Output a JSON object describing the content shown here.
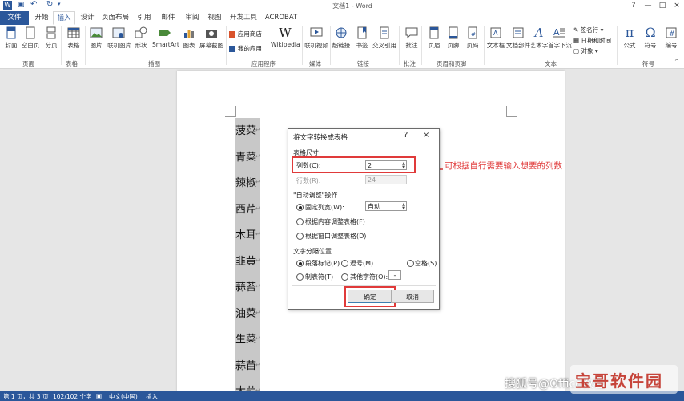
{
  "app": {
    "title": "文档1 - Word",
    "quick_access": [
      "save-icon",
      "undo-icon",
      "redo-icon"
    ],
    "window_controls": [
      "?",
      "—",
      "□",
      "×"
    ]
  },
  "tabs": [
    {
      "label": "文件",
      "state": "file"
    },
    {
      "label": "开始"
    },
    {
      "label": "插入",
      "state": "active"
    },
    {
      "label": "设计"
    },
    {
      "label": "页面布局"
    },
    {
      "label": "引用"
    },
    {
      "label": "邮件"
    },
    {
      "label": "审阅"
    },
    {
      "label": "视图"
    },
    {
      "label": "开发工具"
    },
    {
      "label": "ACROBAT"
    }
  ],
  "ribbon": {
    "buttons": [
      {
        "label": "封面",
        "icon": "cover-page-icon"
      },
      {
        "label": "空白页",
        "icon": "blank-page-icon"
      },
      {
        "label": "分页",
        "icon": "page-break-icon"
      },
      {
        "label": "表格",
        "icon": "table-icon"
      },
      {
        "label": "图片",
        "icon": "picture-icon"
      },
      {
        "label": "联机图片",
        "icon": "online-picture-icon"
      },
      {
        "label": "形状",
        "icon": "shapes-icon"
      },
      {
        "label": "SmartArt",
        "icon": "smartart-icon"
      },
      {
        "label": "图表",
        "icon": "chart-icon"
      },
      {
        "label": "屏幕截图",
        "icon": "screenshot-icon"
      },
      {
        "label": "应用商店",
        "icon": "store-icon"
      },
      {
        "label": "我的应用",
        "icon": "my-apps-icon"
      },
      {
        "label": "Wikipedia",
        "icon": "wikipedia-icon"
      },
      {
        "label": "联机视频",
        "icon": "online-video-icon"
      },
      {
        "label": "超链接",
        "icon": "hyperlink-icon"
      },
      {
        "label": "书签",
        "icon": "bookmark-icon"
      },
      {
        "label": "交叉引用",
        "icon": "cross-reference-icon"
      },
      {
        "label": "批注",
        "icon": "comment-icon"
      },
      {
        "label": "页眉",
        "icon": "header-icon"
      },
      {
        "label": "页脚",
        "icon": "footer-icon"
      },
      {
        "label": "页码",
        "icon": "page-number-icon"
      },
      {
        "label": "文本框",
        "icon": "textbox-icon"
      },
      {
        "label": "文档部件",
        "icon": "quick-parts-icon"
      },
      {
        "label": "艺术字",
        "icon": "wordart-icon"
      },
      {
        "label": "首字下沉",
        "icon": "drop-cap-icon"
      },
      {
        "label": "签名行",
        "icon": "signature-line-icon"
      },
      {
        "label": "日期和时间",
        "icon": "date-time-icon"
      },
      {
        "label": "对象",
        "icon": "object-icon"
      },
      {
        "label": "公式",
        "icon": "equation-icon"
      },
      {
        "label": "符号",
        "icon": "symbol-icon"
      },
      {
        "label": "编号",
        "icon": "number-icon"
      }
    ],
    "groups": [
      "页面",
      "表格",
      "插图",
      "应用程序",
      "媒体",
      "链接",
      "批注",
      "页眉和页脚",
      "文本",
      "符号"
    ]
  },
  "document": {
    "column_items": [
      "菠菜",
      "青菜",
      "辣椒",
      "西芹",
      "木耳",
      "韭黄",
      "蒜苔",
      "油菜",
      "生菜",
      "蒜苗",
      "大蒜"
    ],
    "paragraph_mark": "↵"
  },
  "dialog": {
    "title": "将文字转换成表格",
    "help": "?",
    "close": "×",
    "size_section": "表格尺寸",
    "columns_label": "列数(C):",
    "columns_value": "2",
    "rows_label": "行数(R):",
    "rows_value": "24",
    "autofit_section": "\"自动调整\"操作",
    "fixed_width_label": "固定列宽(W):",
    "fixed_width_value": "自动",
    "autofit_contents_label": "根据内容调整表格(F)",
    "autofit_window_label": "根据窗口调整表格(D)",
    "separator_section": "文字分隔位置",
    "sep_paragraph": "段落标记(P)",
    "sep_comma": "逗号(M)",
    "sep_space": "空格(S)",
    "sep_tab": "制表符(T)",
    "sep_other": "其他字符(O):",
    "sep_other_value": "-",
    "ok_label": "确定",
    "cancel_label": "取消"
  },
  "annotation": "可根据自行需要输入想要的列数",
  "status_bar": {
    "page": "第 1 页，共 3 页",
    "words": "102/102 个字",
    "language": "中文(中国)",
    "mode": "插入"
  },
  "watermarks": {
    "sohu": "搜狐号@Office教程",
    "site": "宝哥软件园"
  },
  "colors": {
    "accent": "#2b579a",
    "highlight_red": "#e03a3a",
    "column_gray": "#c8c8c8"
  }
}
